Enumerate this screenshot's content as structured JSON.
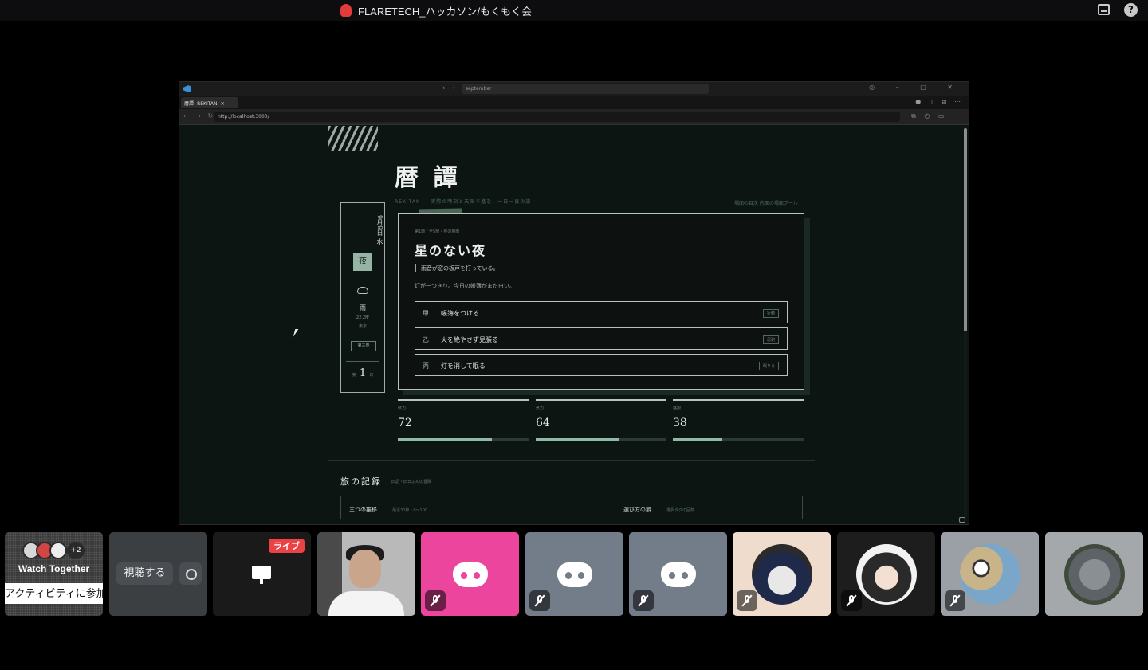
{
  "window": {
    "title": "FLARETECH_ハッカソン/もくもく会"
  },
  "browser": {
    "address_top": "september",
    "tab_label": "暦譚 -REKITAN-",
    "url": "http://localhost:3000/"
  },
  "page": {
    "title": "暦 譚",
    "subtitle": "REKITAN — 実際の時刻と天気で進む、一日一頁の旅",
    "subtitle_right": "場面の目次 内面の場面ブール",
    "side": {
      "date": "9月9日 水",
      "night": "夜",
      "weather": "雨",
      "temp": "22.2度",
      "place": "東京",
      "chapter": "第三巻",
      "day_prefix": "第",
      "day": "1",
      "day_suffix": "日"
    },
    "scene": {
      "crumb": "第1節 / 全5節・夜の場面",
      "title": "星のない夜",
      "line1": "雨音が窓の板戸を打っている。",
      "line2": "灯が一つきり。今日の帳簿がまだ白い。",
      "choices": [
        {
          "mark": "甲",
          "label": "帳簿をつける",
          "tag": "行動"
        },
        {
          "mark": "乙",
          "label": "火を絶やさず見張る",
          "tag": "忍耐"
        },
        {
          "mark": "丙",
          "label": "灯を消して眠る",
          "tag": "眠りる"
        }
      ]
    },
    "stats": [
      {
        "label": "体力",
        "value": "72",
        "pct": 72
      },
      {
        "label": "気力",
        "value": "64",
        "pct": 64
      },
      {
        "label": "路銀",
        "value": "38",
        "pct": 38
      }
    ],
    "log": {
      "title": "旅の記録",
      "sub": "旧記・旧日ぶんの冒険",
      "cards": [
        {
          "title": "三つの推移",
          "sub": "最近30節・0〜100"
        },
        {
          "title": "選び方の癖",
          "sub": "選択タグの回数"
        }
      ]
    }
  },
  "participants": {
    "watch": {
      "extra_count": "+2",
      "title": "Watch Together",
      "join": "アクティビティに参加"
    },
    "view": {
      "label": "視聴する"
    },
    "live": {
      "badge": "ライブ"
    }
  },
  "colors": {
    "pink": "#eb459e",
    "gray": "#737c89",
    "accent": "#8fbaa6"
  }
}
